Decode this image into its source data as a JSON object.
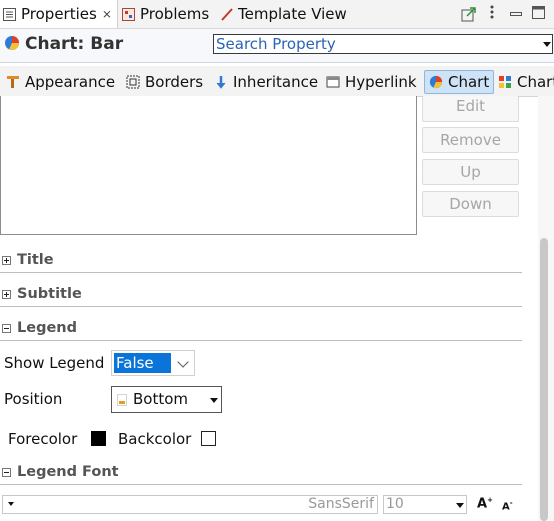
{
  "view_tabs": [
    {
      "label": "Properties",
      "close": "⨯",
      "icon": "properties-icon",
      "active": true
    },
    {
      "label": "Problems",
      "icon": "problems-icon",
      "active": false
    },
    {
      "label": "Template View",
      "icon": "template-view-icon",
      "active": false
    }
  ],
  "header": {
    "title": "Chart: Bar",
    "icon": "chart-pie-icon"
  },
  "search": {
    "value": "Search Property"
  },
  "category_tabs": [
    {
      "label": "Appearance",
      "icon": "appearance-icon"
    },
    {
      "label": "Borders",
      "icon": "borders-icon"
    },
    {
      "label": "Inheritance",
      "icon": "inheritance-icon"
    },
    {
      "label": "Hyperlink",
      "icon": "hyperlink-icon"
    },
    {
      "label": "Chart",
      "icon": "chart-pie-icon",
      "selected": true
    },
    {
      "label": "Chart",
      "icon": "chart-grid-icon"
    }
  ],
  "list_buttons": {
    "edit": "Edit",
    "remove": "Remove",
    "up": "Up",
    "down": "Down"
  },
  "sections": {
    "title": "Title",
    "subtitle": "Subtitle",
    "legend": "Legend",
    "legend_font": "Legend Font"
  },
  "legend": {
    "show_label": "Show Legend",
    "show_value": "False",
    "position_label": "Position",
    "position_value": "Bottom",
    "forecolor_label": "Forecolor",
    "forecolor": "#000000",
    "backcolor_label": "Backcolor",
    "backcolor": "#ffffff"
  },
  "font": {
    "family": "SansSerif",
    "size": "10",
    "grow": "A",
    "shrink": "A"
  },
  "colors": {
    "accent": "#0a74d8",
    "selected_tab": "#cfe3f7",
    "link_text": "#2a64b7"
  }
}
